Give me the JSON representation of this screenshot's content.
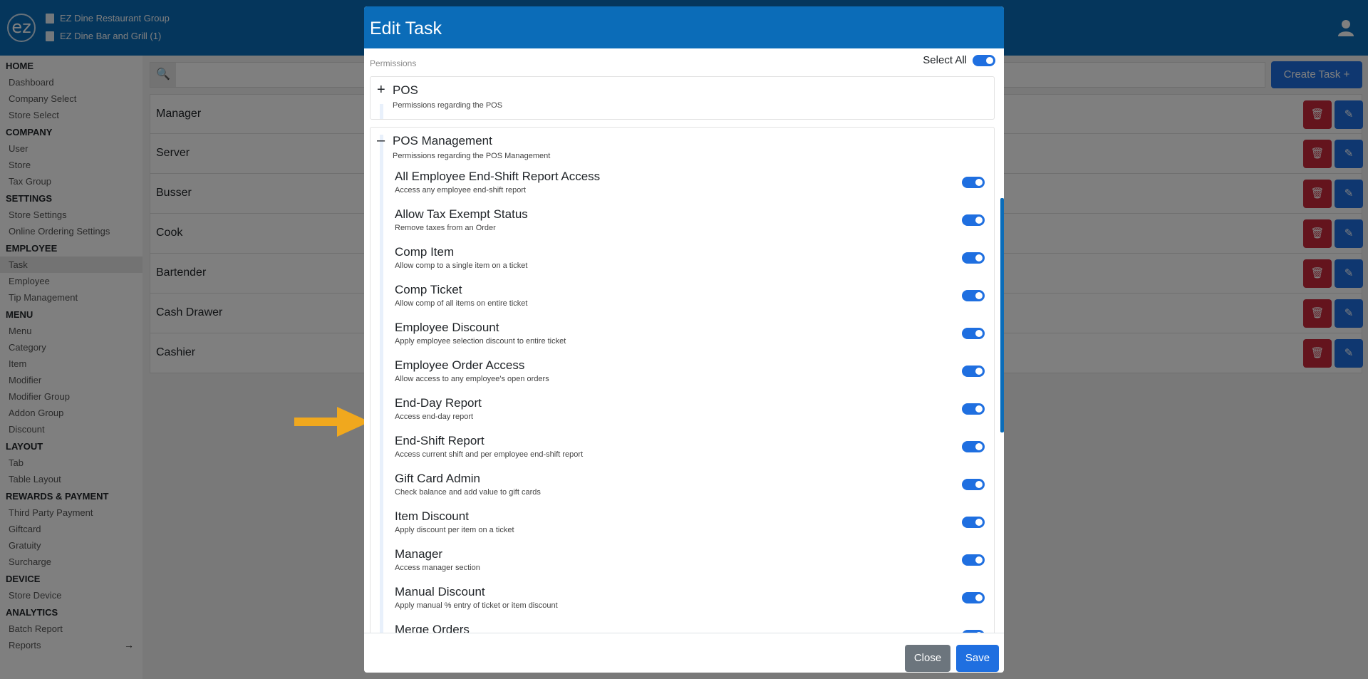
{
  "header": {
    "logo_text": "ez",
    "org_name": "EZ Dine Restaurant Group",
    "store_name": "EZ Dine Bar and Grill (1)"
  },
  "sidebar": {
    "sections": [
      {
        "title": "HOME",
        "items": [
          "Dashboard",
          "Company Select",
          "Store Select"
        ]
      },
      {
        "title": "COMPANY",
        "items": [
          "User",
          "Store",
          "Tax Group"
        ]
      },
      {
        "title": "SETTINGS",
        "items": [
          "Store Settings",
          "Online Ordering Settings"
        ]
      },
      {
        "title": "EMPLOYEE",
        "items": [
          "Task",
          "Employee",
          "Tip Management"
        ]
      },
      {
        "title": "MENU",
        "items": [
          "Menu",
          "Category",
          "Item",
          "Modifier",
          "Modifier Group",
          "Addon Group",
          "Discount"
        ]
      },
      {
        "title": "LAYOUT",
        "items": [
          "Tab",
          "Table Layout"
        ]
      },
      {
        "title": "REWARDS & PAYMENT",
        "items": [
          "Third Party Payment",
          "Giftcard",
          "Gratuity",
          "Surcharge"
        ]
      },
      {
        "title": "DEVICE",
        "items": [
          "Store Device"
        ]
      },
      {
        "title": "ANALYTICS",
        "items": [
          "Batch Report",
          "Reports"
        ]
      }
    ],
    "active_item": "Task"
  },
  "main": {
    "create_label": "Create Task",
    "tasks": [
      "Manager",
      "Server",
      "Busser",
      "Cook",
      "Bartender",
      "Cash Drawer",
      "Cashier"
    ]
  },
  "modal": {
    "title": "Edit Task",
    "permissions_label": "Permissions",
    "select_all_label": "Select All",
    "select_all_on": true,
    "groups": [
      {
        "title": "POS",
        "description": "Permissions regarding the POS",
        "expanded": false
      },
      {
        "title": "POS Management",
        "description": "Permissions regarding the POS Management",
        "expanded": true
      }
    ],
    "items": [
      {
        "title": "All Employee End-Shift Report Access",
        "desc": "Access any employee end-shift report",
        "on": true
      },
      {
        "title": "Allow Tax Exempt Status",
        "desc": "Remove taxes from an Order",
        "on": true
      },
      {
        "title": "Comp Item",
        "desc": "Allow comp to a single item on a ticket",
        "on": true
      },
      {
        "title": "Comp Ticket",
        "desc": "Allow comp of all items on entire ticket",
        "on": true
      },
      {
        "title": "Employee Discount",
        "desc": "Apply employee selection discount to entire ticket",
        "on": true
      },
      {
        "title": "Employee Order Access",
        "desc": "Allow access to any employee's open orders",
        "on": true
      },
      {
        "title": "End-Day Report",
        "desc": "Access end-day report",
        "on": true
      },
      {
        "title": "End-Shift Report",
        "desc": "Access current shift and per employee end-shift report",
        "on": true
      },
      {
        "title": "Gift Card Admin",
        "desc": "Check balance and add value to gift cards",
        "on": true
      },
      {
        "title": "Item Discount",
        "desc": "Apply discount per item on a ticket",
        "on": true
      },
      {
        "title": "Manager",
        "desc": "Access manager section",
        "on": true
      },
      {
        "title": "Manual Discount",
        "desc": "Apply manual % entry of ticket or item discount",
        "on": true
      },
      {
        "title": "Merge Orders",
        "desc": "",
        "on": true
      }
    ],
    "close_label": "Close",
    "save_label": "Save"
  },
  "colors": {
    "brand_blue": "#0b6cb8",
    "primary": "#1f6fe0",
    "danger": "#c9283b",
    "arrow": "#f0a81e"
  }
}
